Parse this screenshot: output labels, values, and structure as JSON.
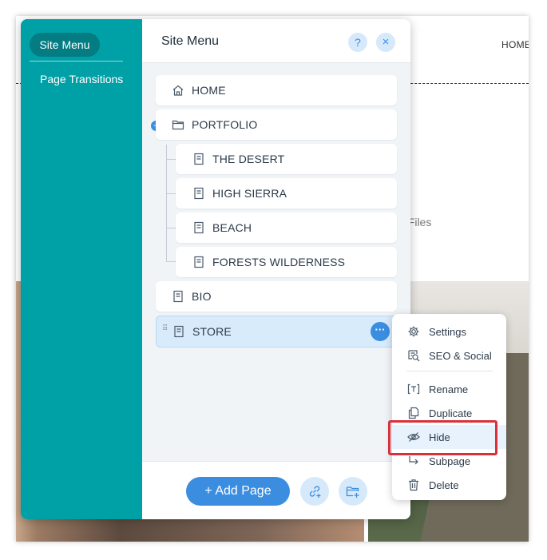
{
  "background": {
    "nav_label": "HOME",
    "files_text": "al Files"
  },
  "sidebar": {
    "active_item": "Site Menu",
    "items": [
      "Site Menu",
      "Page Transitions"
    ]
  },
  "panel": {
    "title": "Site Menu",
    "help_label": "?",
    "close_label": "×"
  },
  "pages": [
    {
      "label": "HOME",
      "icon": "home-icon",
      "level": 0
    },
    {
      "label": "PORTFOLIO",
      "icon": "folder-icon",
      "level": 0,
      "expanded": true
    },
    {
      "label": "THE DESERT",
      "icon": "page-icon",
      "level": 1
    },
    {
      "label": "HIGH SIERRA",
      "icon": "page-icon",
      "level": 1
    },
    {
      "label": "BEACH",
      "icon": "page-icon",
      "level": 1
    },
    {
      "label": "FORESTS WILDERNESS",
      "icon": "page-icon",
      "level": 1
    },
    {
      "label": "BIO",
      "icon": "page-icon",
      "level": 0
    },
    {
      "label": "STORE",
      "icon": "page-icon",
      "level": 0,
      "selected": true
    }
  ],
  "footer": {
    "add_page_label": "+ Add Page",
    "link_icon": "add-link-icon",
    "folder_icon": "add-folder-icon"
  },
  "context_menu": {
    "items": [
      {
        "label": "Settings",
        "icon": "gear-icon"
      },
      {
        "label": "SEO & Social",
        "icon": "seo-icon"
      },
      {
        "label": "Rename",
        "icon": "rename-icon"
      },
      {
        "label": "Duplicate",
        "icon": "duplicate-icon"
      },
      {
        "label": "Hide",
        "icon": "eye-hide-icon",
        "highlighted": true
      },
      {
        "label": "Subpage",
        "icon": "subpage-icon"
      },
      {
        "label": "Delete",
        "icon": "trash-icon"
      }
    ]
  },
  "colors": {
    "sidebar": "#00a0a7",
    "accent": "#3b8de0",
    "highlight_box": "#d9303a"
  }
}
